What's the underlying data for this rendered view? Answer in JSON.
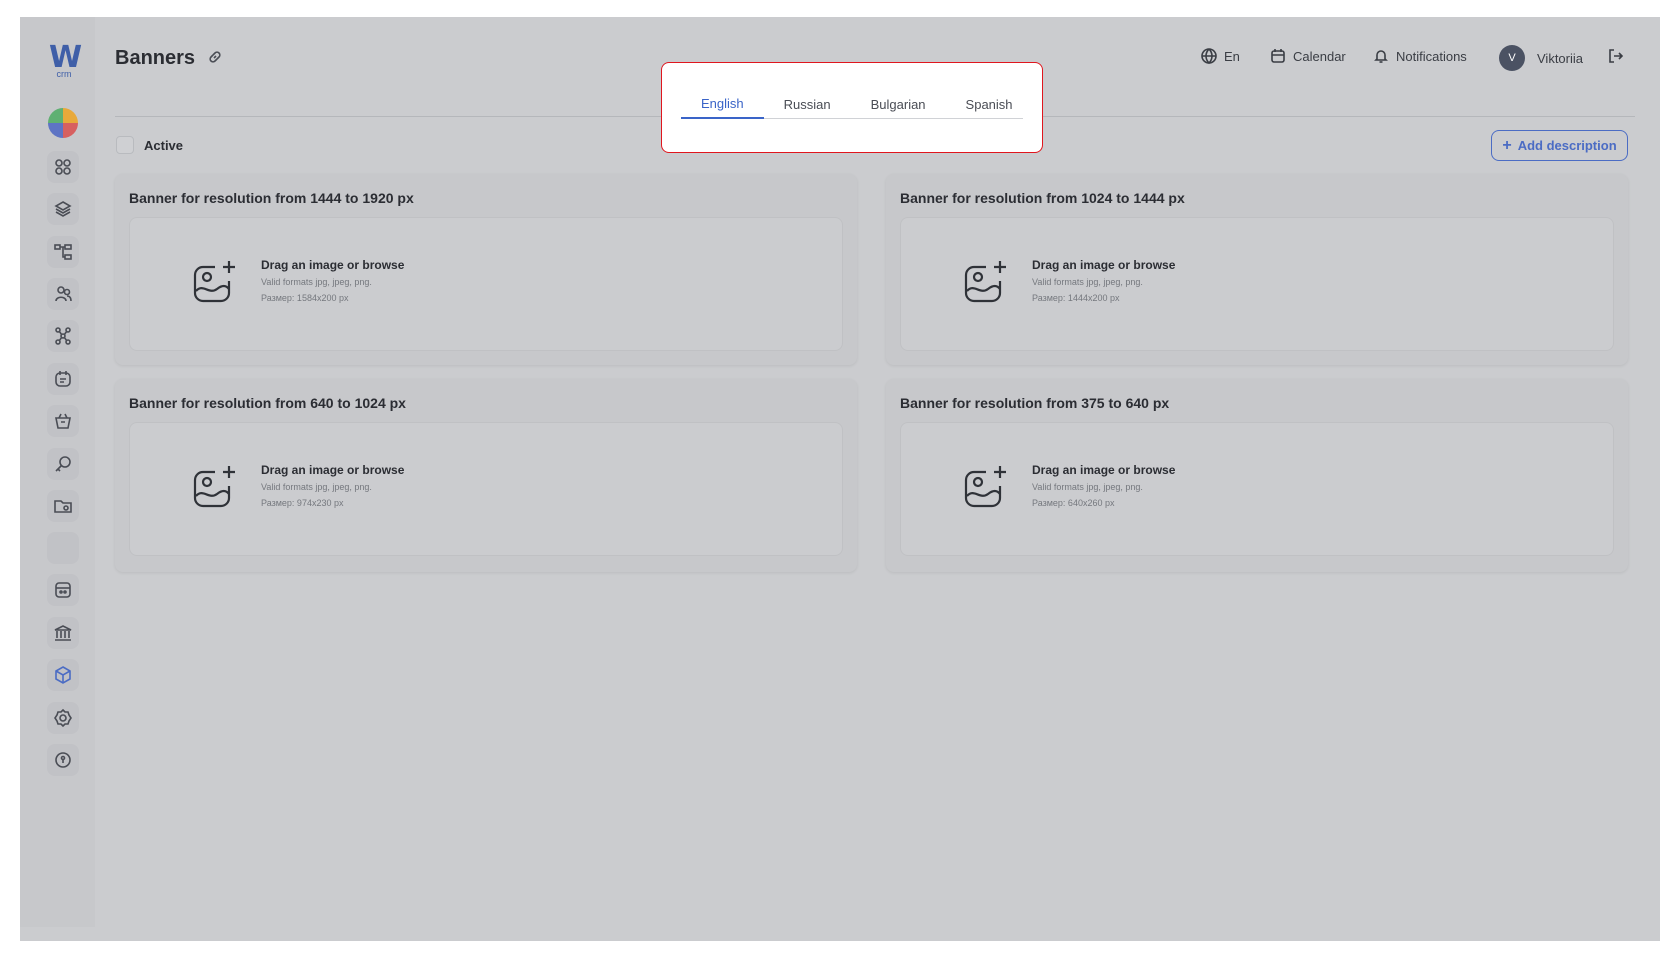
{
  "logo": {
    "mark": "W",
    "sub": "crm"
  },
  "header": {
    "title": "Banners"
  },
  "topnav": {
    "lang": "En",
    "calendar": "Calendar",
    "notifications": "Notifications",
    "avatar_initial": "V",
    "user": "Viktoriia"
  },
  "toolbar": {
    "active_label": "Active",
    "add_description": "Add description"
  },
  "tabs": [
    {
      "label": "English",
      "active": true
    },
    {
      "label": "Russian",
      "active": false
    },
    {
      "label": "Bulgarian",
      "active": false
    },
    {
      "label": "Spanish",
      "active": false
    }
  ],
  "banners": [
    {
      "title": "Banner for resolution from 1444 to 1920 px",
      "drop": "Drag an image or browse",
      "formats": "Valid formats jpg, jpeg, png.",
      "size": "Размер: 1584x200 px"
    },
    {
      "title": "Banner for resolution from 1024 to 1444 px",
      "drop": "Drag an image or browse",
      "formats": "Valid formats jpg, jpeg, png.",
      "size": "Размер: 1444x200 px"
    },
    {
      "title": "Banner for resolution from 640 to 1024 px",
      "drop": "Drag an image or browse",
      "formats": "Valid formats jpg, jpeg, png.",
      "size": "Размер: 974x230 px"
    },
    {
      "title": "Banner for resolution from 375 to 640 px",
      "drop": "Drag an image or browse",
      "formats": "Valid formats jpg, jpeg, png.",
      "size": "Размер: 640x260 px"
    }
  ],
  "sidebar_icons": [
    "dashboard-icon",
    "layers-icon",
    "tree-icon",
    "users-icon",
    "network-icon",
    "notes-icon",
    "basket-icon",
    "key-icon",
    "folder-icon",
    "blank-icon",
    "wallet-icon",
    "bank-icon",
    "cube-icon",
    "settings-icon",
    "shield-icon"
  ],
  "colors": {
    "accent": "#3a64c8",
    "highlight_border": "#e0161e",
    "overlay": "#cbcccf"
  }
}
